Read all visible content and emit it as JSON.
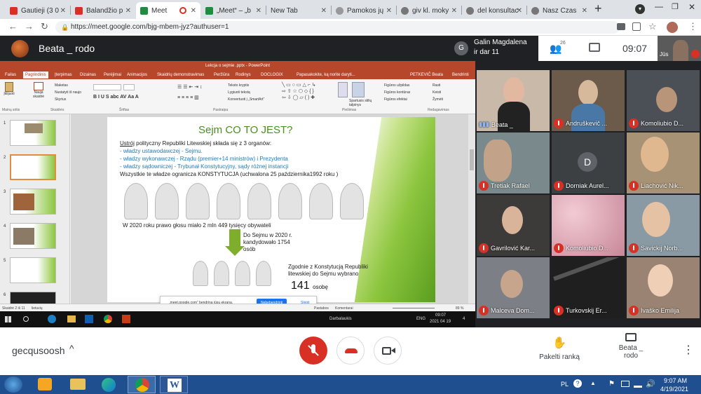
{
  "browser": {
    "tabs": [
      {
        "label": "Gautieji (3 0",
        "color": "#d93025"
      },
      {
        "label": "Balandžio p",
        "color": "#d93025"
      },
      {
        "label": "Meet",
        "color": "#1e8e3e"
      },
      {
        "label": "„Meet“ – „b",
        "color": "#1e8e3e"
      },
      {
        "label": "New Tab",
        "color": "#dee1e6"
      },
      {
        "label": "Pamokos jų",
        "color": "#999"
      },
      {
        "label": "giv kl. moky",
        "color": "#555"
      },
      {
        "label": "del konsultac",
        "color": "#555"
      },
      {
        "label": "Nasz Czas",
        "color": "#555"
      }
    ],
    "url": "https://meet.google.com/bjg-mbem-jyz?authuser=1"
  },
  "meet": {
    "presenter_title": "Beata _ rodo",
    "pinned_name": "Galin Magdalena",
    "pinned_sub": "ir dar 11",
    "pinned_initial": "G",
    "people_count": "26",
    "time": "09:07",
    "self_label": "Jūs",
    "meeting_code": "gecqusoosh",
    "raise_hand": "Pakelti ranką",
    "present_label_1": "Beata _",
    "present_label_2": "rodo"
  },
  "ppt": {
    "window_title": "Lekcja o sejmie .pptx - PowerPoint",
    "tabs": [
      "Failas",
      "Pagrindinis",
      "Įterpimas",
      "Dizainas",
      "Perėjimai",
      "Animacijos",
      "Skaidrių demonstravimas",
      "Peržiūra",
      "Rodinys",
      "DOCLOGIX"
    ],
    "tell_me": "Papasakokite, ką norite daryti...",
    "user": "PETKEVIČ Beata",
    "share": "Bendrinti",
    "groups": [
      "Mainų sritis",
      "Skaidrės",
      "Šriftas",
      "Pastraipa",
      "Piešimas",
      "Redagavimas"
    ],
    "buttons": {
      "paste": "Įklijuoti",
      "new_slide": "Nauja skaidrė",
      "layout": "Maketas",
      "reset": "Nustatyti iš naujo",
      "section": "Skyrius",
      "find": "Rasti",
      "replace": "Keisti",
      "select": "Žymėti",
      "text_dir": "Teksto kryptis",
      "align_text": "Lygiuoti tekstą",
      "smartart": "Konvertuoti į „SmartArt“",
      "quick_styles": "Spartusis stilių talpinys",
      "fill": "Figūros užpildas",
      "outline": "Figūros kontūras",
      "effects": "Figūros efektai"
    },
    "status_left": "Skaidrė 2 iš 11",
    "status_lang": "lietuvių",
    "status_notes": "Pastabos",
    "status_comments": "Komentarai",
    "zoom": "89 %",
    "notify_text": "„meet.google.com“ bendrina jūsų ekraną.",
    "notify_stop": "Nebebendrinti",
    "notify_hide": "Slėpti"
  },
  "slide": {
    "title": "Sejm CO TO JEST?",
    "intro_underline": "Ustrój",
    "intro": " polityczny Republiki Litewskiej składa się z 3 organów:",
    "bullets": [
      "władzy ustawodawczej - Sejmu.",
      "władzy wykonawczej - Rządu (premier+14 ministrów) i Prezydenta",
      "władzy sądowniczej - Trybunał Konstytucyjny, sądy różnej instancji"
    ],
    "constitution": "Wszystkie te władze ogranicza KONSTYTUCJA (uchwalona 25 października1992 roku )",
    "voters": "W 2020 roku prawo głosu miało 2 mln 449 tysięcy obywateli",
    "candidates": "Do Sejmu w 2020 r. kandydowało 1754 osób",
    "constitution2": "Zgodnie z Konstytucją Republiki litewskiej do Sejmu wybrano",
    "count": "141",
    "count_unit": "osobę"
  },
  "win_inner_taskbar": {
    "lang": "ENG",
    "time": "09:07",
    "date": "2021 04 19",
    "item": "Darbalaukis",
    "notif": "4"
  },
  "participants": [
    {
      "name": "Beata _",
      "muted": false,
      "bg": "#c9b9a8"
    },
    {
      "name": "Andruškevič ...",
      "muted": true,
      "bg": "#6c5a4a"
    },
    {
      "name": "Komoliubio D...",
      "muted": true,
      "bg": "#4b4f56"
    },
    {
      "name": "Tretiak Rafael",
      "muted": true,
      "bg": "#7a8a8c"
    },
    {
      "name": "Dorniak Aurel...",
      "muted": true,
      "bg": "#3c4043",
      "initial": "D"
    },
    {
      "name": "Liachović Nik...",
      "muted": true,
      "bg": "#a89275"
    },
    {
      "name": "Gavrilović Kar...",
      "muted": true,
      "bg": "#3d3a3a"
    },
    {
      "name": "Komoliubio D...",
      "muted": true,
      "bg": "#d9a7b3"
    },
    {
      "name": "Savickij Norb...",
      "muted": true,
      "bg": "#8a9aa4"
    },
    {
      "name": "Malceva Dom...",
      "muted": true,
      "bg": "#7c7f86"
    },
    {
      "name": "Turkovskij Er...",
      "muted": true,
      "bg": "#1f1f1f"
    },
    {
      "name": "Ivaško Emilija",
      "muted": true,
      "bg": "#9a8372"
    }
  ],
  "os_taskbar": {
    "lang": "PL",
    "time": "9:07 AM",
    "date": "4/19/2021"
  }
}
